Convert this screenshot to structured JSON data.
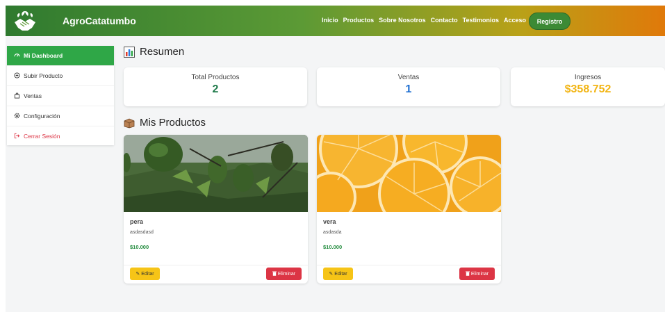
{
  "navbar": {
    "brand": "AgroCatatumbo",
    "logo_icon": "handshake-leaf-icon",
    "links": [
      "Inicio",
      "Productos",
      "Sobre Nosotros",
      "Contacto",
      "Testimonios",
      "Acceso"
    ],
    "register_label": "Registro"
  },
  "sidebar": {
    "items": [
      {
        "label": "Mi Dashboard",
        "icon": "gauge-icon",
        "active": true
      },
      {
        "label": "Subir Producto",
        "icon": "plus-circle-icon"
      },
      {
        "label": "Ventas",
        "icon": "bag-icon"
      },
      {
        "label": "Configuración",
        "icon": "gear-icon"
      },
      {
        "label": "Cerrar Sesión",
        "icon": "logout-icon"
      }
    ]
  },
  "summary": {
    "title": "Resumen",
    "stats": [
      {
        "label": "Total Productos",
        "value": "2",
        "color": "#1f7a4a"
      },
      {
        "label": "Ventas",
        "value": "1",
        "color": "#1f6fd1"
      },
      {
        "label": "Ingresos",
        "value": "$358.752",
        "color": "#f2b515"
      }
    ]
  },
  "products": {
    "title": "Mis Productos",
    "items": [
      {
        "name": "pera",
        "description": "asdasdasd",
        "price": "$10.000",
        "image": "avocado-tree-photo",
        "edit_label": "Editar",
        "delete_label": "Eliminar"
      },
      {
        "name": "vera",
        "description": "asdasda",
        "price": "$10.000",
        "image": "orange-slices-photo",
        "edit_label": "Editar",
        "delete_label": "Eliminar"
      }
    ]
  },
  "colors": {
    "primary": "#2fa747",
    "edit": "#f6c417",
    "delete": "#dc3545"
  }
}
